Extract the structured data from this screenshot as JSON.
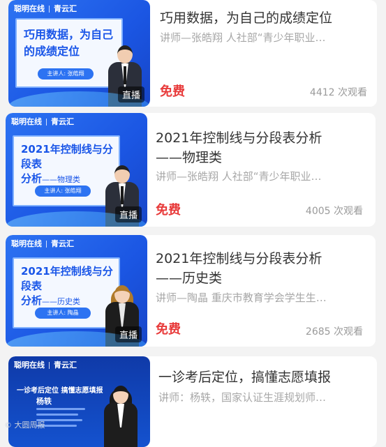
{
  "cards": [
    {
      "thumb_brand": "聪明在线",
      "thumb_brand2": "青云汇",
      "thumb_title": "巧用数据，为自己的成绩定位",
      "thumb_speaker": "主讲人: 张皓翔",
      "live_label": "直播",
      "title": "巧用数据，为自己的成绩定位",
      "teacher": "讲师—张皓翔 人社部“青少年职业…",
      "price": "免费",
      "views": "4412 次观看"
    },
    {
      "thumb_brand": "聪明在线",
      "thumb_brand2": "青云汇",
      "thumb_title_main": "2021年控制线与分段表",
      "thumb_title_sub_a": "分析",
      "thumb_title_sub_b": "——物理类",
      "thumb_speaker": "主讲人: 张皓翔",
      "live_label": "直播",
      "title_line1": "2021年控制线与分段表分析",
      "title_line2": "——物理类",
      "teacher": "讲师—张皓翔 人社部“青少年职业…",
      "price": "免费",
      "views": "4005 次观看"
    },
    {
      "thumb_brand": "聪明在线",
      "thumb_brand2": "青云汇",
      "thumb_title_main": "2021年控制线与分段表",
      "thumb_title_sub_a": "分析",
      "thumb_title_sub_b": "——历史类",
      "thumb_speaker": "主讲人: 陶晶",
      "live_label": "直播",
      "title_line1": "2021年控制线与分段表分析",
      "title_line2": "——历史类",
      "teacher": "讲师—陶晶 重庆市教育学会学生生…",
      "price": "免费",
      "views": "2685 次观看"
    },
    {
      "thumb_brand": "聪明在线",
      "thumb_brand2": "青云汇",
      "thumb_heading": "一诊考后定位 搞懂志愿填报",
      "thumb_name": "杨轶",
      "title": "一诊考后定位，搞懂志愿填报",
      "teacher": "讲师：杨轶，国家认证生涯规划师…"
    }
  ],
  "watermark": "大圆周报"
}
